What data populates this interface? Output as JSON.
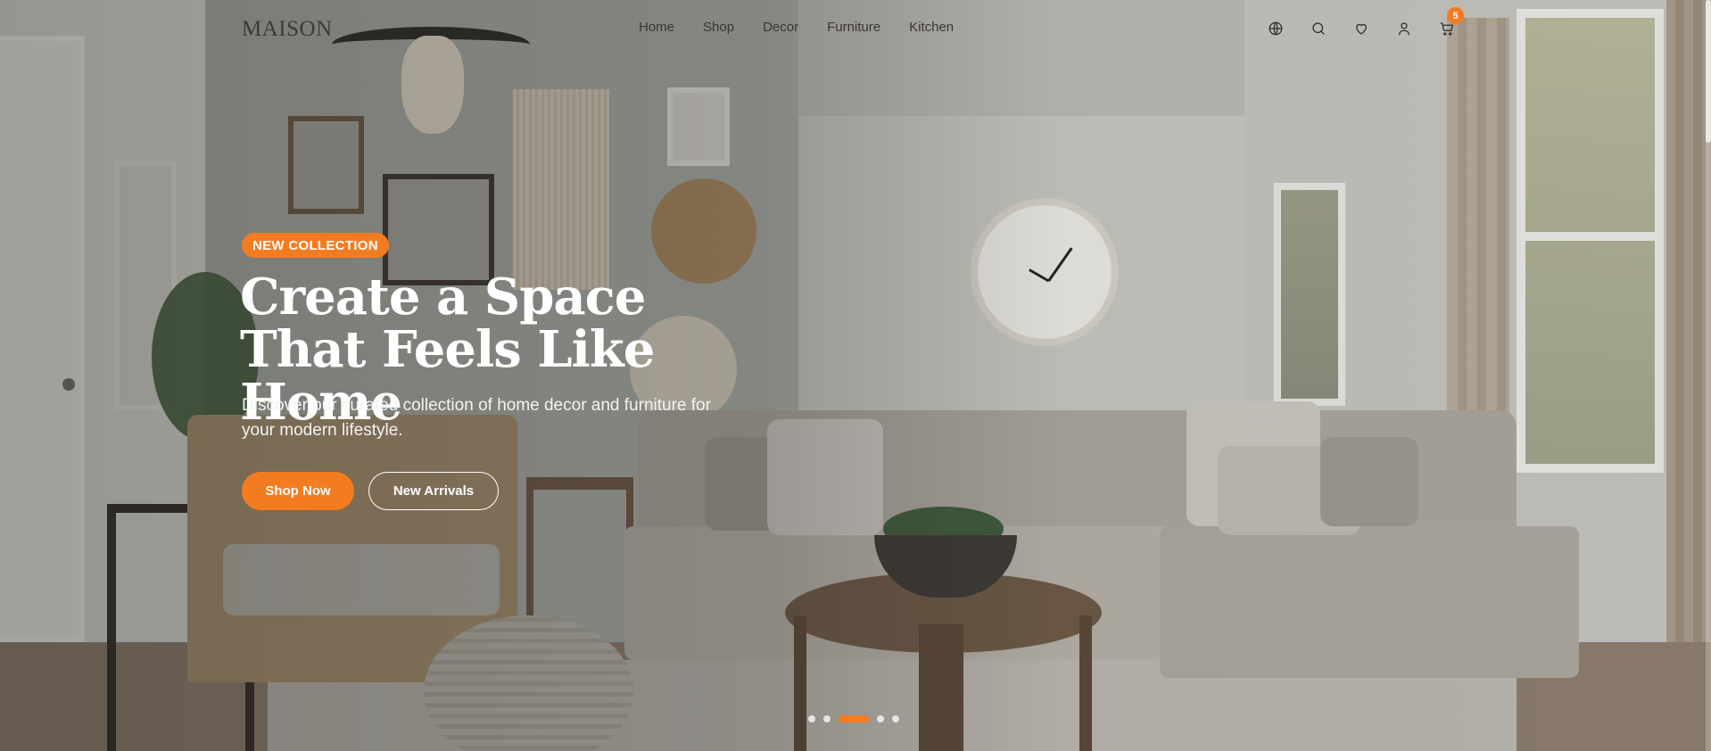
{
  "brand": {
    "logo": "MAISON",
    "accent_color": "#f47c20"
  },
  "nav": {
    "items": [
      {
        "label": "Home"
      },
      {
        "label": "Shop"
      },
      {
        "label": "Decor"
      },
      {
        "label": "Furniture"
      },
      {
        "label": "Kitchen"
      }
    ]
  },
  "header_icons": {
    "language": "globe-icon",
    "search": "search-icon",
    "wishlist": "heart-icon",
    "account": "user-icon",
    "cart": "cart-icon",
    "cart_count": "5"
  },
  "hero": {
    "badge": "NEW COLLECTION",
    "headline": "Create a Space That Feels Like Home",
    "subtext": "Discover our curated collection of home decor and furniture for your modern lifestyle.",
    "primary_cta": "Shop Now",
    "secondary_cta": "New Arrivals",
    "slides_total": 5,
    "active_slide": 3
  }
}
